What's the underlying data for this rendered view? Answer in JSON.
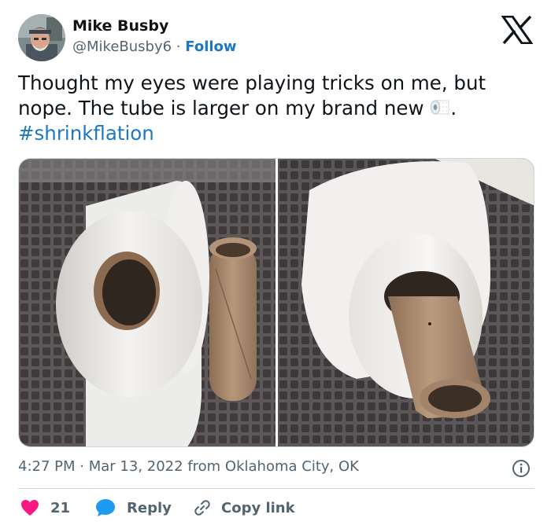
{
  "author": {
    "name": "Mike Busby",
    "handle": "@MikeBusby6",
    "separator": "·",
    "follow_label": "Follow"
  },
  "tweet": {
    "text_part1": "Thought my eyes were playing tricks on me, but nope. The tube is larger on my brand new ",
    "emoji": "toilet-paper-roll-emoji",
    "text_part2": ".",
    "hashtag": "#shrinkflation"
  },
  "photos": [
    {
      "alt": "toilet paper roll next to empty cardboard tube on gray waffle blanket"
    },
    {
      "alt": "old cardboard tube inserted into new toilet paper roll"
    }
  ],
  "meta": {
    "time": "4:27 PM",
    "separator": "·",
    "date": "Mar 13, 2022",
    "location": "from Oklahoma City, OK"
  },
  "actions": {
    "like_count": "21",
    "reply_label": "Reply",
    "copy_label": "Copy link"
  },
  "colors": {
    "link_blue": "#1d77c3",
    "like_red": "#f91880",
    "reply_blue": "#1d9bf0",
    "muted_gray": "#536471"
  }
}
